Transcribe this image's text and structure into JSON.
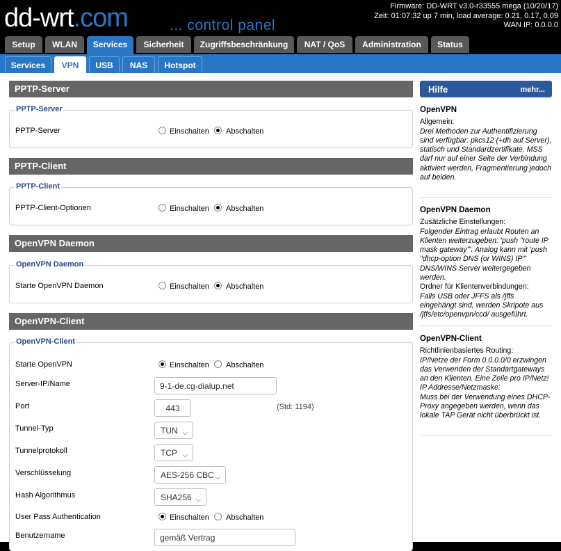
{
  "header": {
    "logo_main": "dd-wrt",
    "logo_suffix": ".com",
    "tagline": "... control panel",
    "firmware": "Firmware: DD-WRT v3.0-r33555 mega (10/20/17)",
    "uptime": "Zeit: 01:07:32 up 7 min, load average: 0.21, 0.17, 0.09",
    "wan_ip": "WAN IP: 0.0.0.0"
  },
  "main_tabs": [
    "Setup",
    "WLAN",
    "Services",
    "Sicherheit",
    "Zugriffsbeschränkung",
    "NAT / QoS",
    "Administration",
    "Status"
  ],
  "sub_tabs": [
    "Services",
    "VPN",
    "USB",
    "NAS",
    "Hotspot"
  ],
  "radio_labels": {
    "on": "Einschalten",
    "off": "Abschalten"
  },
  "sections": {
    "pptp_server": {
      "header": "PPTP-Server",
      "legend": "PPTP-Server",
      "row_label": "PPTP-Server"
    },
    "pptp_client": {
      "header": "PPTP-Client",
      "legend": "PPTP-Client",
      "row_label": "PPTP-Client-Optionen"
    },
    "openvpn_daemon": {
      "header": "OpenVPN Daemon",
      "legend": "OpenVPN Daemon",
      "row_label": "Starte OpenVPN Daemon"
    },
    "openvpn_client": {
      "header": "OpenVPN-Client",
      "legend": "OpenVPN-Client",
      "start_label": "Starte OpenVPN",
      "server_label": "Server-IP/Name",
      "server_value": "9-1-de.cg-dialup.net",
      "port_label": "Port",
      "port_value": "443",
      "port_default": "(Std: 1194)",
      "tunnel_type_label": "Tunnel-Typ",
      "tunnel_type_value": "TUN",
      "tunnel_proto_label": "Tunnelprotokoll",
      "tunnel_proto_value": "TCP",
      "encryption_label": "Verschlüsselung",
      "encryption_value": "AES-256 CBC",
      "hash_label": "Hash Algorithmus",
      "hash_value": "SHA256",
      "userpass_label": "User Pass Authentication",
      "username_label": "Benutzername",
      "username_value": "gemäß Vertrag"
    }
  },
  "help": {
    "title": "Hilfe",
    "more": "mehr...",
    "openvpn_title": "OpenVPN",
    "openvpn_sub": "Allgemein:",
    "openvpn_text": "Drei Methoden zur Authentifizierung sind verfügbar: pkcs12 (+dh auf Server), statisch und Standardzertifikate. MSS darf nur auf einer Seite der Verbindung aktiviert werden, Fragmentierung jedoch auf beiden.",
    "daemon_title": "OpenVPN Daemon",
    "daemon_sub": "Zusätzliche Einstellungen:",
    "daemon_text": "Folgender Eintrag erlaubt Routen an Klienten weiterzugeben: 'push \"route IP mask gateway\"'. Analog kann mit 'push \"dhcp-option DNS (or WINS) IP\"' DNS/WINS Server weitergegeben werden.",
    "daemon_sub2": "Ordner für Klientenverbindungen:",
    "daemon_text2": "Falls USB oder JFFS als /jffs eingehängt sind, werden Skripote aus /jffs/etc/openvpn/ccd/ ausgeführt.",
    "client_title": "OpenVPN-Client",
    "client_sub": "Richtlinienbasiertes Routing:",
    "client_text": "IP/Netze der Form 0.0.0.0/0 erzwingen das Verwenden der Standartgateways an den Klienten. Eine Zeile pro IP/Netz!",
    "client_text2": "IP Addresse/Netzmaske:",
    "client_text3": "Muss bei der Verwendung eines DHCP-Proxy angegeben werden, wenn das lokale TAP Gerät nicht überbrückt ist."
  }
}
